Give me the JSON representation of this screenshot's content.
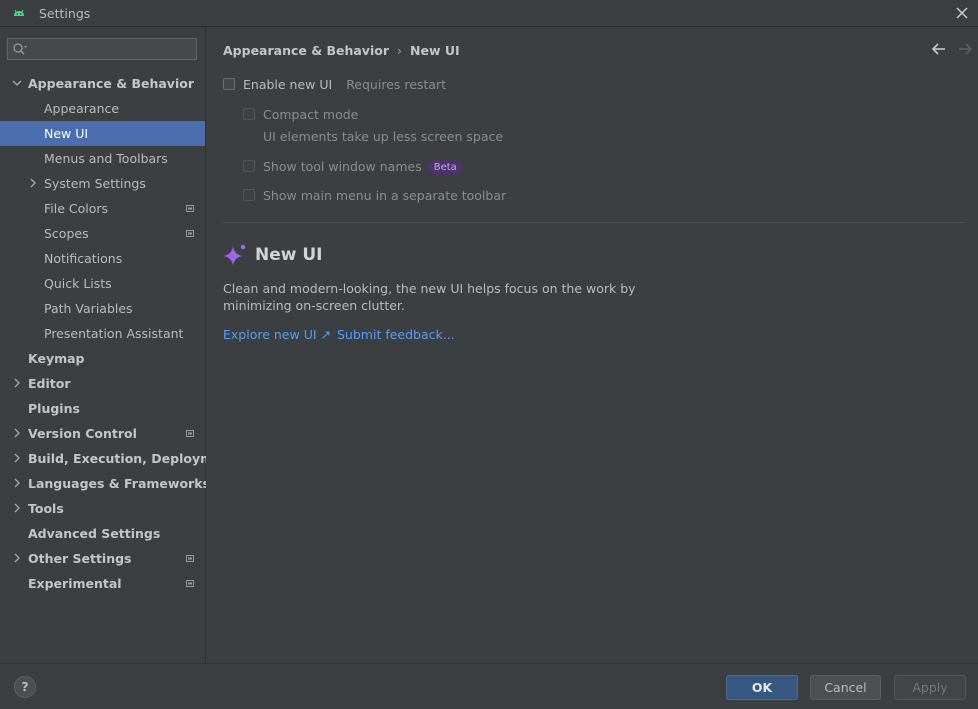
{
  "window": {
    "title": "Settings"
  },
  "search": {
    "placeholder": "",
    "value": ""
  },
  "sidebar": {
    "items": [
      {
        "label": "Appearance & Behavior",
        "bold": true,
        "expanded": true,
        "level": 0
      },
      {
        "label": "Appearance",
        "level": 1
      },
      {
        "label": "New UI",
        "level": 1,
        "selected": true
      },
      {
        "label": "Menus and Toolbars",
        "level": 1
      },
      {
        "label": "System Settings",
        "level": 1,
        "collapsed": true
      },
      {
        "label": "File Colors",
        "level": 1,
        "modified": true
      },
      {
        "label": "Scopes",
        "level": 1,
        "modified": true
      },
      {
        "label": "Notifications",
        "level": 1
      },
      {
        "label": "Quick Lists",
        "level": 1
      },
      {
        "label": "Path Variables",
        "level": 1
      },
      {
        "label": "Presentation Assistant",
        "level": 1
      },
      {
        "label": "Keymap",
        "bold": true,
        "level": 0
      },
      {
        "label": "Editor",
        "bold": true,
        "collapsed": true,
        "level": 0
      },
      {
        "label": "Plugins",
        "bold": true,
        "level": 0
      },
      {
        "label": "Version Control",
        "bold": true,
        "collapsed": true,
        "level": 0,
        "modified": true
      },
      {
        "label": "Build, Execution, Deployment",
        "bold": true,
        "collapsed": true,
        "level": 0
      },
      {
        "label": "Languages & Frameworks",
        "bold": true,
        "collapsed": true,
        "level": 0
      },
      {
        "label": "Tools",
        "bold": true,
        "collapsed": true,
        "level": 0
      },
      {
        "label": "Advanced Settings",
        "bold": true,
        "level": 0
      },
      {
        "label": "Other Settings",
        "bold": true,
        "collapsed": true,
        "level": 0,
        "modified": true
      },
      {
        "label": "Experimental",
        "bold": true,
        "level": 0,
        "modified": true
      }
    ]
  },
  "breadcrumb": {
    "parent": "Appearance & Behavior",
    "separator": "›",
    "current": "New UI"
  },
  "options": {
    "enable_new_ui": {
      "label": "Enable new UI",
      "hint": "Requires restart",
      "checked": false
    },
    "compact_mode": {
      "label": "Compact mode",
      "hint": "UI elements take up less screen space",
      "checked": false
    },
    "show_tool_window_names": {
      "label": "Show tool window names",
      "badge": "Beta",
      "checked": false
    },
    "separate_main_menu": {
      "label": "Show main menu in a separate toolbar",
      "checked": false
    }
  },
  "promo": {
    "title": "New UI",
    "description": "Clean and modern-looking, the new UI helps focus on the work by minimizing on-screen clutter.",
    "explore_link": "Explore new UI ↗",
    "feedback_link": "Submit feedback..."
  },
  "footer": {
    "help": "?",
    "ok": "OK",
    "cancel": "Cancel",
    "apply": "Apply"
  },
  "colors": {
    "background": "#3c3f41",
    "selection": "#4b6eaf",
    "link": "#589df6",
    "primary_button": "#365880",
    "beta_badge_bg": "#4a3468",
    "beta_badge_text": "#c3a5f0",
    "sparkle_icon": "#a064f0"
  }
}
